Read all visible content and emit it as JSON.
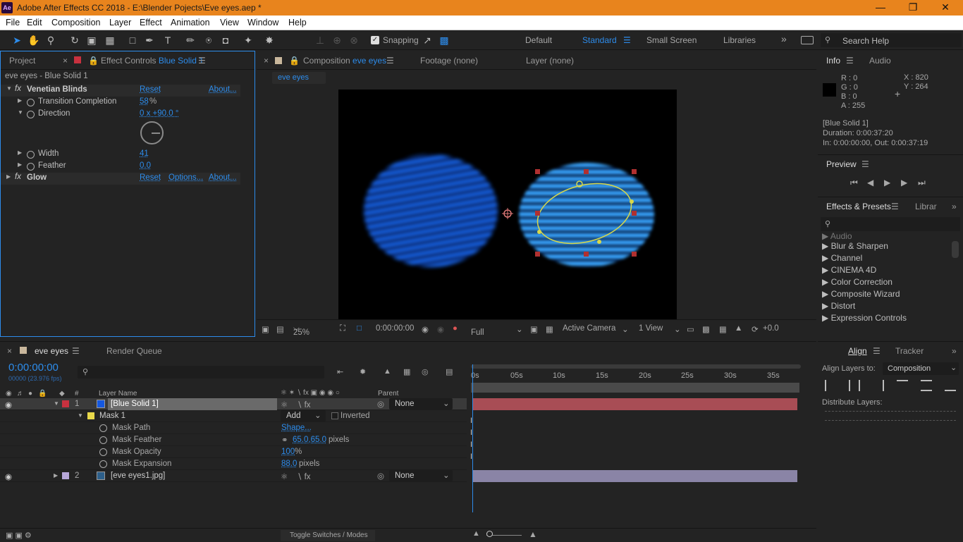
{
  "app": {
    "title": "Adobe After Effects CC 2018 - E:\\Blender Pojects\\Eve eyes.aep *",
    "logo": "Ae"
  },
  "menu": [
    "File",
    "Edit",
    "Composition",
    "Layer",
    "Effect",
    "Animation",
    "View",
    "Window",
    "Help"
  ],
  "toolbar": {
    "snapping": "Snapping",
    "workspaces": [
      "Default",
      "Standard",
      "Small Screen",
      "Libraries"
    ],
    "search_placeholder": "Search Help"
  },
  "left_panel": {
    "tab_project": "Project",
    "tab_effect_controls": "Effect Controls",
    "effect_controls_target": "Blue Solid 1",
    "subtitle": "eve eyes - Blue Solid 1",
    "effects": [
      {
        "name": "Venetian Blinds",
        "reset": "Reset",
        "about": "About..."
      },
      {
        "name": "Glow",
        "reset": "Reset",
        "options": "Options...",
        "about": "About..."
      }
    ],
    "props": {
      "transition_label": "Transition Completion",
      "transition_value": "58",
      "transition_unit": "%",
      "direction_label": "Direction",
      "direction_value": "0 x +90.0 °",
      "width_label": "Width",
      "width_value": "41",
      "feather_label": "Feather",
      "feather_value": "0.0"
    }
  },
  "viewer": {
    "tab_composition": "Composition",
    "comp_name": "eve eyes",
    "tab_footage": "Footage (none)",
    "tab_layer": "Layer (none)",
    "breadcrumb": "eve eyes",
    "zoom": "25%",
    "time": "0:00:00:00",
    "resolution": "Full",
    "camera": "Active Camera",
    "view": "1 View",
    "exposure": "+0.0"
  },
  "info": {
    "tab_info": "Info",
    "tab_audio": "Audio",
    "r": "R : 0",
    "g": "G : 0",
    "b": "B : 0",
    "a": "A : 255",
    "x": "X : 820",
    "y": "Y : 264",
    "layer": "[Blue Solid 1]",
    "duration": "Duration: 0:00:37:20",
    "inout": "In: 0:00:00:00, Out: 0:00:37:19"
  },
  "preview": {
    "title": "Preview"
  },
  "effects_presets": {
    "title": "Effects & Presets",
    "tab_libraries": "Librar",
    "search_placeholder": "",
    "items": [
      "Audio",
      "Blur & Sharpen",
      "Channel",
      "CINEMA 4D",
      "Color Correction",
      "Composite Wizard",
      "Distort",
      "Expression Controls"
    ]
  },
  "align": {
    "title": "Align",
    "tab_tracker": "Tracker",
    "align_to_label": "Align Layers to:",
    "align_to_value": "Composition",
    "distribute": "Distribute Layers:"
  },
  "timeline": {
    "tab_comp": "eve eyes",
    "tab_render": "Render Queue",
    "timecode": "0:00:00:00",
    "frames": "00000 (23.976 fps)",
    "col_layer_name": "Layer Name",
    "col_parent": "Parent",
    "col_hash": "#",
    "ruler": [
      "0s",
      "05s",
      "10s",
      "15s",
      "20s",
      "25s",
      "30s",
      "35s"
    ],
    "layers": [
      {
        "num": "1",
        "name": "[Blue Solid 1]",
        "parent": "None"
      },
      {
        "num": "2",
        "name": "[eve eyes1.jpg]",
        "parent": "None"
      }
    ],
    "mask": {
      "name": "Mask 1",
      "mode": "Add",
      "inverted": "Inverted",
      "path_label": "Mask Path",
      "path_value": "Shape...",
      "feather_label": "Mask Feather",
      "feather_value": "65.0,65.0",
      "feather_unit": "pixels",
      "opacity_label": "Mask Opacity",
      "opacity_value": "100",
      "opacity_unit": "%",
      "expansion_label": "Mask Expansion",
      "expansion_value": "88.0",
      "expansion_unit": "pixels"
    },
    "toggle": "Toggle Switches / Modes"
  }
}
